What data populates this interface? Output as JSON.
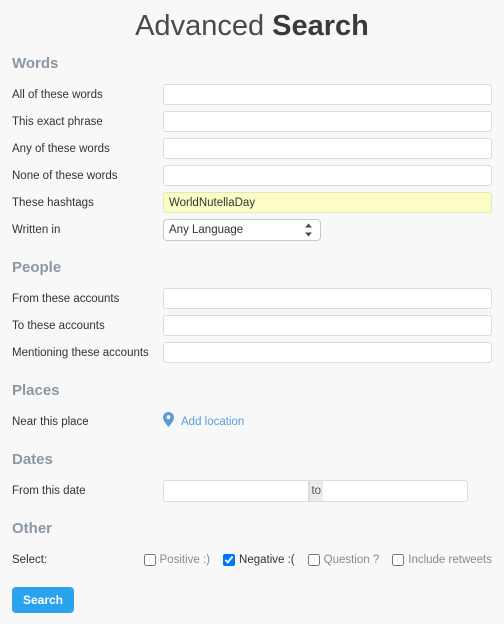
{
  "title": {
    "prefix": "Advanced",
    "suffix": "Search"
  },
  "sections": {
    "words": {
      "heading": "Words",
      "rows": [
        {
          "label": "All of these words",
          "value": "",
          "placeholder": ""
        },
        {
          "label": "This exact phrase",
          "value": "",
          "placeholder": ""
        },
        {
          "label": "Any of these words",
          "value": "",
          "placeholder": ""
        },
        {
          "label": "None of these words",
          "value": "",
          "placeholder": ""
        },
        {
          "label": "These hashtags",
          "value": "WorldNutellaDay",
          "placeholder": ""
        }
      ],
      "language": {
        "label": "Written in",
        "selected": "Any Language",
        "options": [
          "Any Language"
        ]
      }
    },
    "people": {
      "heading": "People",
      "rows": [
        {
          "label": "From these accounts",
          "value": "",
          "placeholder": ""
        },
        {
          "label": "To these accounts",
          "value": "",
          "placeholder": ""
        },
        {
          "label": "Mentioning these accounts",
          "value": "",
          "placeholder": ""
        }
      ]
    },
    "places": {
      "heading": "Places",
      "label": "Near this place",
      "add_location_text": "Add location",
      "pin_icon": "map-pin-icon"
    },
    "dates": {
      "heading": "Dates",
      "label": "From this date",
      "from_value": "",
      "from_placeholder": "",
      "separator": "to",
      "to_value": "",
      "to_placeholder": ""
    },
    "other": {
      "heading": "Other",
      "label": "Select:",
      "checkboxes": [
        {
          "label": "Positive :)",
          "checked": false,
          "dim": true
        },
        {
          "label": "Negative :(",
          "checked": true,
          "dim": false
        },
        {
          "label": "Question ?",
          "checked": false,
          "dim": true
        },
        {
          "label": "Include retweets",
          "checked": false,
          "dim": true
        }
      ]
    }
  },
  "actions": {
    "search_label": "Search"
  },
  "colors": {
    "accent": "#2aa3ef",
    "heading": "#8b97a3",
    "link": "#5b9bd8",
    "autofill": "#fbfdc4",
    "background": "#f8f8f8",
    "input_border": "#d6dde5"
  }
}
